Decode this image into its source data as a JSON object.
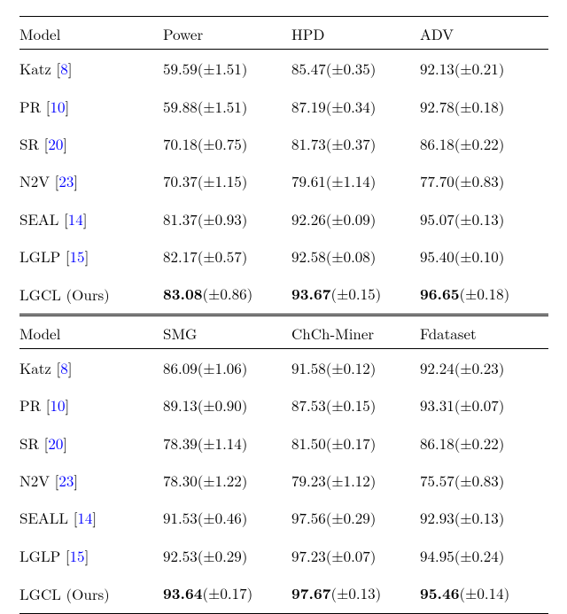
{
  "table1": {
    "header": {
      "model": "Model",
      "c1": "Power",
      "c2": "HPD",
      "c3": "ADV"
    },
    "rows": [
      {
        "name": "Katz",
        "cite": "8",
        "c1": {
          "v": "59.59",
          "pm": "1.51",
          "bold": false
        },
        "c2": {
          "v": "85.47",
          "pm": "0.35",
          "bold": false
        },
        "c3": {
          "v": "92.13",
          "pm": "0.21",
          "bold": false
        }
      },
      {
        "name": "PR",
        "cite": "10",
        "c1": {
          "v": "59.88",
          "pm": "1.51",
          "bold": false
        },
        "c2": {
          "v": "87.19",
          "pm": "0.34",
          "bold": false
        },
        "c3": {
          "v": "92.78",
          "pm": "0.18",
          "bold": false
        }
      },
      {
        "name": "SR",
        "cite": "20",
        "c1": {
          "v": "70.18",
          "pm": "0.75",
          "bold": false
        },
        "c2": {
          "v": "81.73",
          "pm": "0.37",
          "bold": false
        },
        "c3": {
          "v": "86.18",
          "pm": "0.22",
          "bold": false
        }
      },
      {
        "name": "N2V",
        "cite": "23",
        "c1": {
          "v": "70.37",
          "pm": "1.15",
          "bold": false
        },
        "c2": {
          "v": "79.61",
          "pm": "1.14",
          "bold": false
        },
        "c3": {
          "v": "77.70",
          "pm": "0.83",
          "bold": false
        }
      },
      {
        "name": "SEAL",
        "cite": "14",
        "c1": {
          "v": "81.37",
          "pm": "0.93",
          "bold": false
        },
        "c2": {
          "v": "92.26",
          "pm": "0.09",
          "bold": false
        },
        "c3": {
          "v": "95.07",
          "pm": "0.13",
          "bold": false
        }
      },
      {
        "name": "LGLP",
        "cite": "15",
        "c1": {
          "v": "82.17",
          "pm": "0.57",
          "bold": false
        },
        "c2": {
          "v": "92.58",
          "pm": "0.08",
          "bold": false
        },
        "c3": {
          "v": "95.40",
          "pm": "0.10",
          "bold": false
        }
      },
      {
        "name": "LGCL (Ours)",
        "cite": null,
        "c1": {
          "v": "83.08",
          "pm": "0.86",
          "bold": true
        },
        "c2": {
          "v": "93.67",
          "pm": "0.15",
          "bold": true
        },
        "c3": {
          "v": "96.65",
          "pm": "0.18",
          "bold": true
        }
      }
    ]
  },
  "table2": {
    "header": {
      "model": "Model",
      "c1": "SMG",
      "c2": "ChCh-Miner",
      "c3": "Fdataset"
    },
    "rows": [
      {
        "name": "Katz",
        "cite": "8",
        "c1": {
          "v": "86.09",
          "pm": "1.06",
          "bold": false
        },
        "c2": {
          "v": "91.58",
          "pm": "0.12",
          "bold": false
        },
        "c3": {
          "v": "92.24",
          "pm": "0.23",
          "bold": false
        }
      },
      {
        "name": "PR",
        "cite": "10",
        "c1": {
          "v": "89.13",
          "pm": "0.90",
          "bold": false
        },
        "c2": {
          "v": "87.53",
          "pm": "0.15",
          "bold": false
        },
        "c3": {
          "v": "93.31",
          "pm": "0.07",
          "bold": false
        }
      },
      {
        "name": "SR",
        "cite": "20",
        "c1": {
          "v": "78.39",
          "pm": "1.14",
          "bold": false
        },
        "c2": {
          "v": "81.50",
          "pm": "0.17",
          "bold": false
        },
        "c3": {
          "v": "86.18",
          "pm": "0.22",
          "bold": false
        }
      },
      {
        "name": "N2V",
        "cite": "23",
        "c1": {
          "v": "78.30",
          "pm": "1.22",
          "bold": false
        },
        "c2": {
          "v": "79.23",
          "pm": "1.12",
          "bold": false
        },
        "c3": {
          "v": "75.57",
          "pm": "0.83",
          "bold": false
        }
      },
      {
        "name": "SEALL",
        "cite": "14",
        "c1": {
          "v": "91.53",
          "pm": "0.46",
          "bold": false
        },
        "c2": {
          "v": "97.56",
          "pm": "0.29",
          "bold": false
        },
        "c3": {
          "v": "92.93",
          "pm": "0.13",
          "bold": false
        }
      },
      {
        "name": "LGLP",
        "cite": "15",
        "c1": {
          "v": "92.53",
          "pm": "0.29",
          "bold": false
        },
        "c2": {
          "v": "97.23",
          "pm": "0.07",
          "bold": false
        },
        "c3": {
          "v": "94.95",
          "pm": "0.24",
          "bold": false
        }
      },
      {
        "name": "LGCL (Ours)",
        "cite": null,
        "c1": {
          "v": "93.64",
          "pm": "0.17",
          "bold": true
        },
        "c2": {
          "v": "97.67",
          "pm": "0.13",
          "bold": true
        },
        "c3": {
          "v": "95.46",
          "pm": "0.14",
          "bold": true
        }
      }
    ]
  }
}
